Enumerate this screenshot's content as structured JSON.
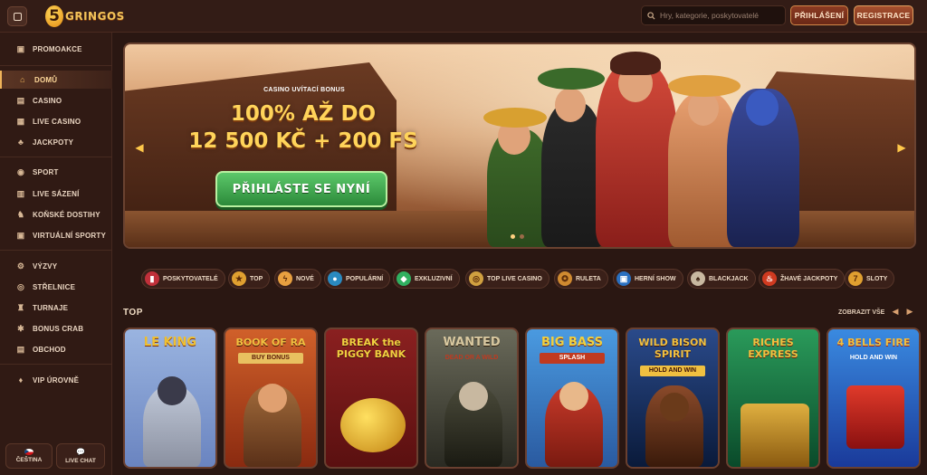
{
  "header": {
    "logo_number": "5",
    "logo_word": "GRINGOS",
    "search_placeholder": "Hry, kategorie, poskytovatelé",
    "login_label": "PŘIHLÁŠENÍ",
    "register_label": "REGISTRACE"
  },
  "sidebar": {
    "items": [
      {
        "label": "PROMOAKCE",
        "icon": "gift-icon"
      },
      {
        "label": "DOMŮ",
        "icon": "home-icon",
        "active": true
      },
      {
        "label": "CASINO",
        "icon": "casino-icon"
      },
      {
        "label": "LIVE CASINO",
        "icon": "live-casino-icon"
      },
      {
        "label": "JACKPOTY",
        "icon": "clover-icon"
      },
      {
        "label": "SPORT",
        "icon": "ball-icon"
      },
      {
        "label": "LIVE SÁZENÍ",
        "icon": "live-bet-icon"
      },
      {
        "label": "KOŇSKÉ DOSTIHY",
        "icon": "horse-icon"
      },
      {
        "label": "VIRTUÁLNÍ SPORTY",
        "icon": "virtual-sport-icon"
      },
      {
        "label": "VÝZVY",
        "icon": "challenge-icon"
      },
      {
        "label": "STŘELNICE",
        "icon": "target-icon"
      },
      {
        "label": "TURNAJE",
        "icon": "trophy-icon"
      },
      {
        "label": "BONUS CRAB",
        "icon": "crab-icon"
      },
      {
        "label": "OBCHOD",
        "icon": "shop-icon"
      },
      {
        "label": "VIP ÚROVNĚ",
        "icon": "vip-icon"
      }
    ],
    "language_label": "ČEŠTINA",
    "chat_label": "LIVE CHAT"
  },
  "banner": {
    "subtitle": "CASINO UVÍTACÍ BONUS",
    "title_line1": "100% AŽ DO",
    "title_line2": "12 500 KČ + 200 FS",
    "cta_label": "PŘIHLÁSTE SE NYNÍ",
    "slide_count": 2,
    "active_slide": 1
  },
  "categories": [
    {
      "label": "POSKYTOVATELÉ",
      "icon": "book-icon",
      "color": "#c0303a"
    },
    {
      "label": "TOP",
      "icon": "star-icon",
      "color": "#e0a030"
    },
    {
      "label": "NOVÉ",
      "icon": "lightning-icon",
      "color": "#e8a040"
    },
    {
      "label": "POPULÁRNÍ",
      "icon": "globe-icon",
      "color": "#2a8ac0"
    },
    {
      "label": "EXKLUZIVNÍ",
      "icon": "diamond-icon",
      "color": "#30b060"
    },
    {
      "label": "TOP LIVE CASINO",
      "icon": "chip-icon",
      "color": "#d0a040"
    },
    {
      "label": "RULETA",
      "icon": "roulette-icon",
      "color": "#d08a30"
    },
    {
      "label": "HERNÍ SHOW",
      "icon": "show-icon",
      "color": "#2a70c0"
    },
    {
      "label": "BLACKJACK",
      "icon": "cards-icon",
      "color": "#c8b8a0"
    },
    {
      "label": "ŽHAVÉ JACKPOTY",
      "icon": "chili-icon",
      "color": "#d03a20"
    },
    {
      "label": "SLOTY",
      "icon": "slot-icon",
      "color": "#e0a030"
    }
  ],
  "top_section": {
    "title": "TOP",
    "view_all": "ZOBRAZIT VŠE",
    "games": [
      {
        "title": "LE KING",
        "subtitle": "",
        "bg": "#8fa8d8",
        "color": "#f0c030"
      },
      {
        "title": "BOOK OF RA",
        "subtitle": "BUY BONUS",
        "bg": "#b84a1a",
        "color": "#f0c040"
      },
      {
        "title": "BREAK the PIGGY BANK",
        "subtitle": "",
        "bg": "#7a1a1a",
        "color": "#f0d040"
      },
      {
        "title": "WANTED",
        "subtitle": "DEAD OR A WILD",
        "bg": "#4a4a3a",
        "color": "#d8c8a0"
      },
      {
        "title": "BIG BASS",
        "subtitle": "SPLASH",
        "bg": "#2a7ac8",
        "color": "#f0d040"
      },
      {
        "title": "WILD BISON SPIRIT",
        "subtitle": "HOLD AND WIN",
        "bg": "#1a3a6a",
        "color": "#f0c040"
      },
      {
        "title": "RICHES EXPRESS",
        "subtitle": "",
        "bg": "#1a7a4a",
        "color": "#f0c040"
      },
      {
        "title": "4 BELLS FIRE",
        "subtitle": "HOLD AND WIN",
        "bg": "#2a70d0",
        "color": "#f0c040"
      }
    ]
  }
}
